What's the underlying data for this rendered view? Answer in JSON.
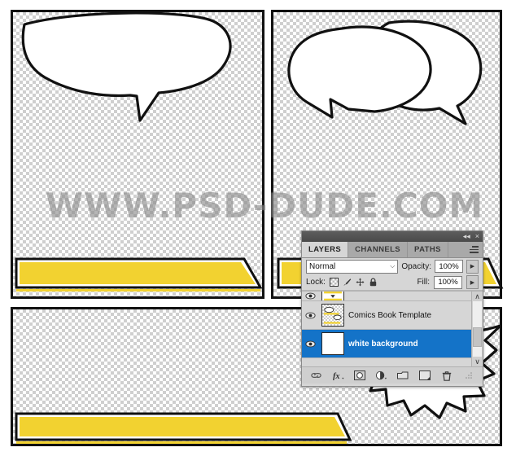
{
  "canvas": {
    "watermark": "WWW.PSD-DUDE.COM",
    "background": "transparency-checkerboard",
    "panel_border_color": "#111111",
    "banner_color": "#f2d230",
    "panels": [
      {
        "name": "panel-top-left",
        "bubble": "single-speech-bubble",
        "banner": true
      },
      {
        "name": "panel-top-right",
        "bubble": "double-speech-bubble",
        "banner": true
      },
      {
        "name": "panel-bottom",
        "bubble": "burst-shape",
        "banner": true
      }
    ]
  },
  "layers_panel": {
    "titlebar": {
      "collapse_icon": "◂◂",
      "close_icon": "×"
    },
    "tabs": [
      {
        "label": "LAYERS",
        "active": true
      },
      {
        "label": "CHANNELS",
        "active": false
      },
      {
        "label": "PATHS",
        "active": false
      }
    ],
    "menu_icon": "panel-menu-icon",
    "blend_mode": {
      "value": "Normal",
      "chevron": "⌵"
    },
    "opacity": {
      "label": "Opacity:",
      "value": "100%",
      "stepper": "▶"
    },
    "fill": {
      "label": "Fill:",
      "value": "100%",
      "stepper": "▶"
    },
    "lock": {
      "label": "Lock:",
      "icons": [
        "lock-transparent-pixels-icon",
        "lock-image-pixels-icon",
        "lock-position-icon",
        "lock-all-icon"
      ]
    },
    "layers": [
      {
        "name": "",
        "visible": true,
        "selected": false,
        "thumbnail": "banner-shape-thumb",
        "clipped": true
      },
      {
        "name": "Comics Book Template",
        "visible": true,
        "selected": false,
        "thumbnail": "transparent-comic-thumb",
        "clipped": false
      },
      {
        "name": "white background",
        "visible": true,
        "selected": true,
        "thumbnail": "white-thumb",
        "clipped": false
      }
    ],
    "scrollbar": {
      "up_arrow": "∧",
      "down_arrow": "∨"
    },
    "footer_buttons": [
      "link-layers-icon",
      "layer-style-fx-icon",
      "layer-mask-icon",
      "adjustment-layer-icon",
      "new-group-icon",
      "new-layer-icon",
      "delete-layer-icon"
    ],
    "selection_color": "#1473c8"
  }
}
